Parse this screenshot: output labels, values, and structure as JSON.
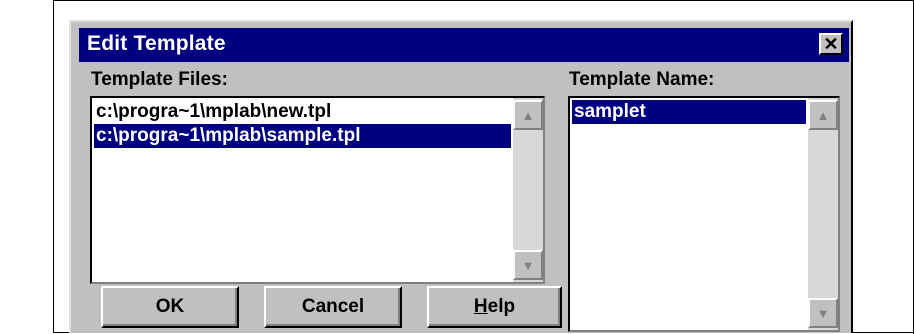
{
  "dialog": {
    "title": "Edit Template",
    "close_glyph": "✕",
    "template_files_label": "Template Files:",
    "template_name_label": "Template Name:",
    "template_files": [
      {
        "path": "c:\\progra~1\\mplab\\new.tpl",
        "selected": false
      },
      {
        "path": "c:\\progra~1\\mplab\\sample.tpl",
        "selected": true
      }
    ],
    "template_names": [
      {
        "name": "samplet",
        "selected": true
      }
    ],
    "buttons": {
      "ok": "OK",
      "cancel": "Cancel",
      "help": "Help"
    },
    "scroll_up_icon": "▲",
    "scroll_down_icon": "▼"
  }
}
